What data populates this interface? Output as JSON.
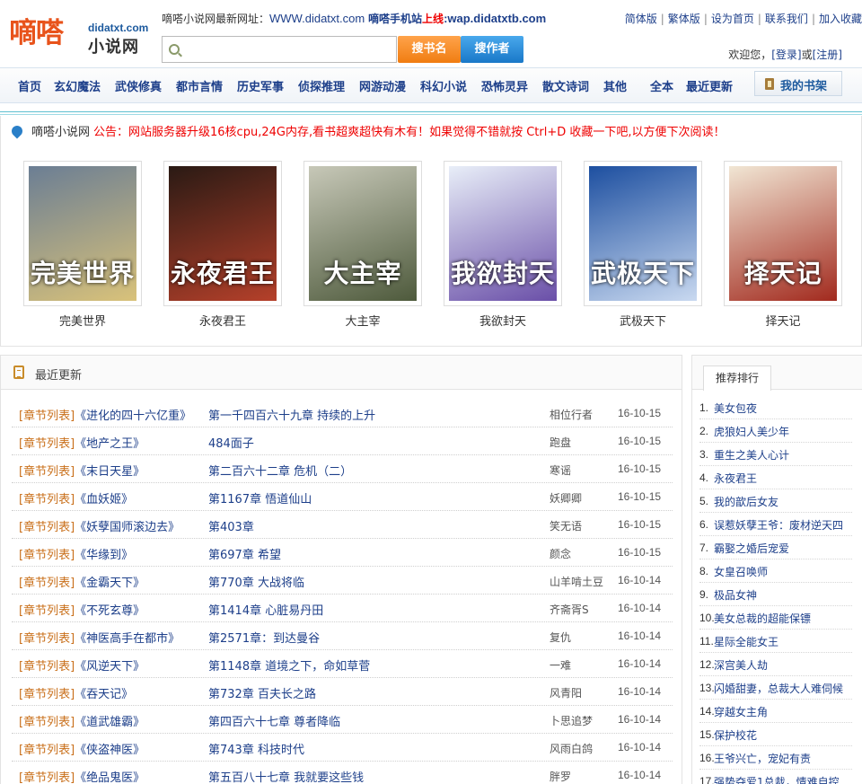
{
  "logo": {
    "text": "嘀嗒",
    "domain": "didatxt.com",
    "sub": "小说网"
  },
  "header": {
    "note_prefix": "嘀嗒小说网最新网址：",
    "url": "WWW.didatxt.com",
    "mobile_label": "嘀嗒手机站",
    "online": "上线",
    "wap": ":wap.didatxtb.com",
    "top_links": [
      "简体版",
      "繁体版",
      "设为首页",
      "联系我们",
      "加入收藏"
    ],
    "search_placeholder": "",
    "btn_name": "搜书名",
    "btn_author": "搜作者",
    "welcome": "欢迎您，",
    "login": "[登录]",
    "or": "或",
    "register": "[注册]"
  },
  "nav": {
    "items": [
      "首页",
      "玄幻魔法",
      "武侠修真",
      "都市言情",
      "历史军事",
      "侦探推理",
      "网游动漫",
      "科幻小说",
      "恐怖灵异",
      "散文诗词",
      "其他",
      "全本",
      "最近更新"
    ],
    "bookshelf": "我的书架"
  },
  "notice": {
    "site": "嘀嗒小说网",
    "message": "公告：网站服务器升级16核cpu,24G内存,看书超爽超快有木有！如果觉得不错就按 Ctrl+D 收藏一下吧,以方便下次阅读！"
  },
  "featured": [
    {
      "name": "完美世界",
      "cover_title": "完美世界",
      "color1": "#6b7e94",
      "color2": "#d9c27a"
    },
    {
      "name": "永夜君王",
      "cover_title": "永夜君王",
      "color1": "#2a1a14",
      "color2": "#b5402a"
    },
    {
      "name": "大主宰",
      "cover_title": "大主宰",
      "color1": "#c7c8b8",
      "color2": "#4e5a3c"
    },
    {
      "name": "我欲封天",
      "cover_title": "我欲封天",
      "color1": "#e8eef8",
      "color2": "#6a4fa8"
    },
    {
      "name": "武极天下",
      "cover_title": "武极天下",
      "color1": "#1d4fa0",
      "color2": "#c9d9f0"
    },
    {
      "name": "择天记",
      "cover_title": "择天记",
      "color1": "#f1e6d4",
      "color2": "#a22a1e"
    }
  ],
  "updates": {
    "title": "最近更新",
    "list_label": "[章节列表]",
    "rows": [
      {
        "book": "《进化的四十六亿重》",
        "chapter": "第一千四百六十九章 持续的上升",
        "author": "相位行者",
        "date": "16-10-15"
      },
      {
        "book": "《地产之王》",
        "chapter": "484面子",
        "author": "跑盘",
        "date": "16-10-15"
      },
      {
        "book": "《末日天星》",
        "chapter": "第二百六十二章 危机（二）",
        "author": "寒谣",
        "date": "16-10-15"
      },
      {
        "book": "《血妖姬》",
        "chapter": "第1167章 悟道仙山",
        "author": "妖卿卿",
        "date": "16-10-15"
      },
      {
        "book": "《妖孽国师滚边去》",
        "chapter": "第403章",
        "author": "笑无语",
        "date": "16-10-15"
      },
      {
        "book": "《华缘到》",
        "chapter": "第697章 希望",
        "author": "颜念",
        "date": "16-10-15"
      },
      {
        "book": "《金霸天下》",
        "chapter": "第770章 大战将临",
        "author": "山羊啃土豆",
        "date": "16-10-14"
      },
      {
        "book": "《不死玄尊》",
        "chapter": "第1414章 心脏易丹田",
        "author": "齐斋胥S",
        "date": "16-10-14"
      },
      {
        "book": "《神医高手在都市》",
        "chapter": "第2571章：到达曼谷",
        "author": "复仇",
        "date": "16-10-14"
      },
      {
        "book": "《风逆天下》",
        "chapter": "第1148章 道境之下，命如草菅",
        "author": "一难",
        "date": "16-10-14"
      },
      {
        "book": "《吞天记》",
        "chapter": "第732章 百夫长之路",
        "author": "风青阳",
        "date": "16-10-14"
      },
      {
        "book": "《道武雄霸》",
        "chapter": "第四百六十七章 尊者降临",
        "author": "卜思追梦",
        "date": "16-10-14"
      },
      {
        "book": "《侠盗神医》",
        "chapter": "第743章 科技时代",
        "author": "风雨白鸽",
        "date": "16-10-14"
      },
      {
        "book": "《绝品鬼医》",
        "chapter": "第五百八十七章 我就要这些钱",
        "author": "胖罗",
        "date": "16-10-14"
      }
    ]
  },
  "ranking": {
    "title": "推荐排行",
    "items": [
      {
        "n": "1.",
        "t": "美女包夜"
      },
      {
        "n": "2.",
        "t": "虎狼妇人美少年"
      },
      {
        "n": "3.",
        "t": "重生之美人心计"
      },
      {
        "n": "4.",
        "t": "永夜君王"
      },
      {
        "n": "5.",
        "t": "我的歆后女友"
      },
      {
        "n": "6.",
        "t": "误惹妖孽王爷：废材逆天四"
      },
      {
        "n": "7.",
        "t": "霸娶之婚后宠爱"
      },
      {
        "n": "8.",
        "t": "女皇召唤师"
      },
      {
        "n": "9.",
        "t": "极品女神"
      },
      {
        "n": "10.",
        "t": "美女总裁的超能保镖"
      },
      {
        "n": "11.",
        "t": "星际全能女王"
      },
      {
        "n": "12.",
        "t": "深宫美人劫"
      },
      {
        "n": "13.",
        "t": "闪婚甜妻，总裁大人难伺候"
      },
      {
        "n": "14.",
        "t": "穿越女主角"
      },
      {
        "n": "15.",
        "t": "保护校花"
      },
      {
        "n": "16.",
        "t": "王爷兴亡，宠妃有责"
      },
      {
        "n": "17.",
        "t": "强势夺爱1总裁，情难自控"
      }
    ]
  }
}
